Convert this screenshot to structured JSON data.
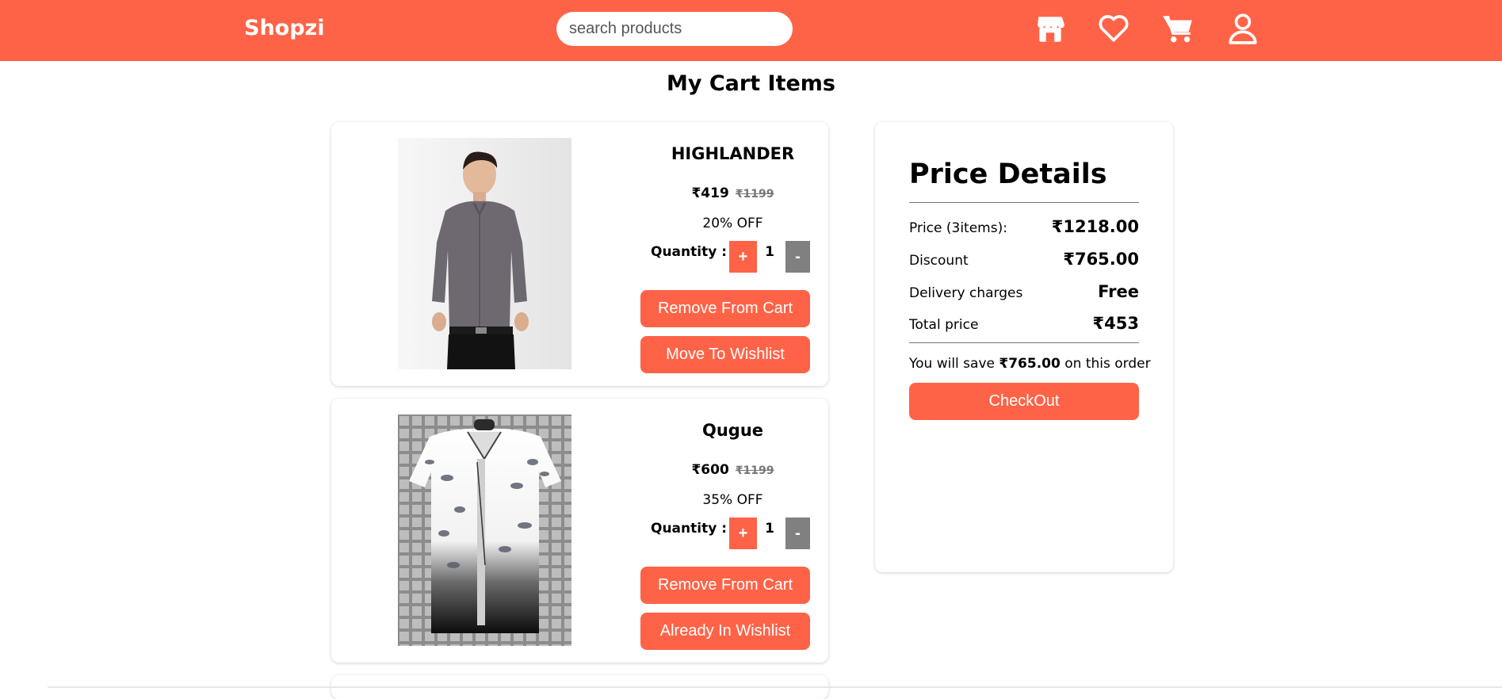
{
  "header": {
    "logo": "Shopzi",
    "search_placeholder": "search products",
    "icons": [
      "store-icon",
      "heart-icon",
      "cart-icon",
      "user-icon"
    ],
    "bg_color": "#ff6347"
  },
  "page_title": "My Cart Items",
  "cart": {
    "items": [
      {
        "name": "HIGHLANDER",
        "price": "₹419",
        "mrp": "₹1199",
        "discount": "20% OFF",
        "quantity_label": "Quantity :",
        "plus": "+",
        "quantity": "1",
        "minus": "-",
        "remove_label": "Remove From Cart",
        "wishlist_label": "Move To Wishlist"
      },
      {
        "name": "Qugue",
        "price": "₹600",
        "mrp": "₹1199",
        "discount": "35% OFF",
        "quantity_label": "Quantity :",
        "plus": "+",
        "quantity": "1",
        "minus": "-",
        "remove_label": "Remove From Cart",
        "wishlist_label": "Already In Wishlist"
      }
    ]
  },
  "summary": {
    "title": "Price Details",
    "rows": [
      {
        "label": "Price (3items):",
        "value": "₹1218.00"
      },
      {
        "label": "Discount",
        "value": "₹765.00"
      },
      {
        "label": "Delivery charges",
        "value": "Free"
      },
      {
        "label": "Total price",
        "value": "₹453"
      }
    ],
    "save_prefix": "You will save",
    "save_amount": "₹765.00",
    "save_suffix": "on this order",
    "checkout_label": "CheckOut"
  },
  "colors": {
    "accent": "#ff6347",
    "minus_button": "#808080"
  }
}
